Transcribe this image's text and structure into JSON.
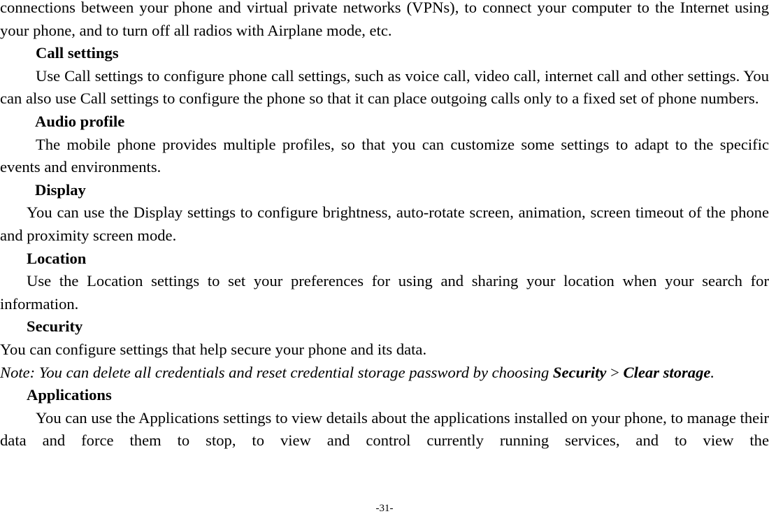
{
  "document": {
    "intro_paragraph": "connections between your phone and virtual private networks (VPNs), to connect your computer to the Internet using your phone, and to turn off all radios with Airplane mode, etc.",
    "sections": [
      {
        "heading": "Call settings",
        "body": "Use Call settings to configure phone call settings, such as voice call, video call, internet call and other settings. You can also use Call settings to configure the phone so that it can place outgoing calls only to a fixed set of phone numbers."
      },
      {
        "heading": "Audio profile",
        "body": "The mobile phone provides multiple profiles, so that you can customize some settings to adapt to the specific events and environments."
      },
      {
        "heading": "Display",
        "body": "You can use the Display settings to configure brightness, auto-rotate screen, animation, screen timeout of the phone and proximity screen mode."
      },
      {
        "heading": "Location",
        "body": "Use the Location settings to set your preferences for using and sharing your location when your search for information."
      },
      {
        "heading": "Security",
        "body": "You can configure settings that help secure your phone and its data.",
        "note": {
          "prefix": "Note: You can delete all credentials and reset credential storage password by choosing ",
          "menu_item_1": "Security",
          "separator": " > ",
          "menu_item_2": "Clear storage",
          "suffix": "."
        }
      },
      {
        "heading": "Applications",
        "body": "You can use the Applications settings to view details about the applications installed on your phone, to manage their data and force them to stop, to view and control currently running services, and to view the"
      }
    ],
    "page_number": "-31-"
  }
}
